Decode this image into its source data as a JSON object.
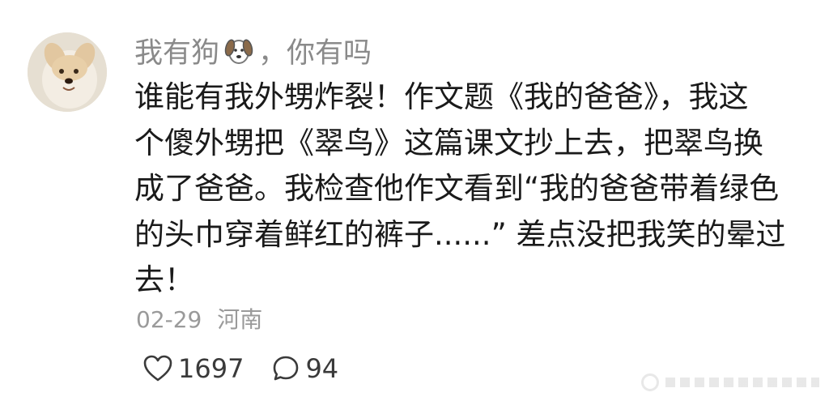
{
  "comment": {
    "username_prefix": "我有狗",
    "username_suffix": "，你有吗",
    "username_emoji_icon": "dog-face-icon",
    "body_lines": [
      "谁能有我外甥炸裂！作文题《我的爸爸》，我这",
      "个傻外甥把《翠鸟》这篇课文抄上去，把翠鸟换",
      "成了爸爸。我检查他作文看到“我的爸爸带着绿色",
      "的头巾穿着鲜红的裤子......” 差点没把我笑的晕过",
      "去！"
    ],
    "date": "02-29",
    "location": "河南"
  },
  "actions": {
    "like_icon": "heart-outline-icon",
    "like_count": "1697",
    "reply_icon": "speech-bubble-icon",
    "reply_count": "94"
  },
  "colors": {
    "username": "#8a8a8a",
    "body_text": "#1a1a1a",
    "meta_text": "#9a9a9a",
    "action_text": "#3a3a3a"
  }
}
